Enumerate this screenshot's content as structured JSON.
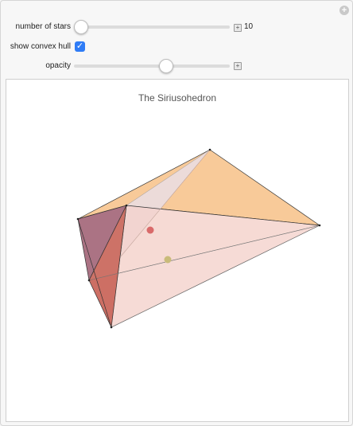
{
  "controls": {
    "stars": {
      "label": "number of stars",
      "value": "10",
      "fraction": 0.0
    },
    "hull": {
      "label": "show convex hull",
      "checked": true
    },
    "opacity": {
      "label": "opacity",
      "fraction": 0.59
    }
  },
  "plot": {
    "title": "The Siriusohedron"
  },
  "colors": {
    "accent": "#2f7cf6",
    "face_orange": "#f5b672",
    "face_pink": "#f4cfc8",
    "face_purple": "#9c5a6e",
    "face_red": "#c4594c",
    "star_red": "#d96a6a",
    "star_yellow": "#c9bb7a"
  },
  "icons": {
    "corner": "plus-circle-icon",
    "stepper": "plus-square-icon",
    "check": "checkmark-icon"
  }
}
